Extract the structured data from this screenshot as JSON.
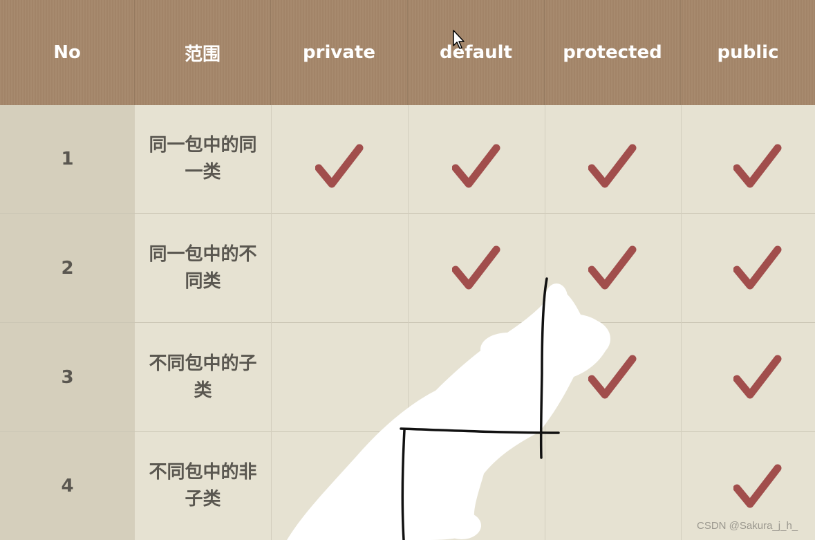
{
  "table": {
    "headers": {
      "no": "No",
      "scope": "范围",
      "private": "private",
      "default": "default",
      "protected": "protected",
      "public": "public"
    },
    "rows": [
      {
        "no": "1",
        "scope": "同一包中的同一类",
        "private": true,
        "default": true,
        "protected": true,
        "public": true
      },
      {
        "no": "2",
        "scope": "同一包中的不同类",
        "private": false,
        "default": true,
        "protected": true,
        "public": true
      },
      {
        "no": "3",
        "scope": "不同包中的子类",
        "private": false,
        "default": false,
        "protected": true,
        "public": true
      },
      {
        "no": "4",
        "scope": "不同包中的非子类",
        "private": false,
        "default": false,
        "protected": false,
        "public": true
      }
    ]
  },
  "colors": {
    "header_bg": "#a5876a",
    "body_bg": "#e6e2d2",
    "no_col_bg": "#d5cfbc",
    "check_color": "#a14e4c"
  },
  "watermark": "CSDN @Sakura_j_h_"
}
